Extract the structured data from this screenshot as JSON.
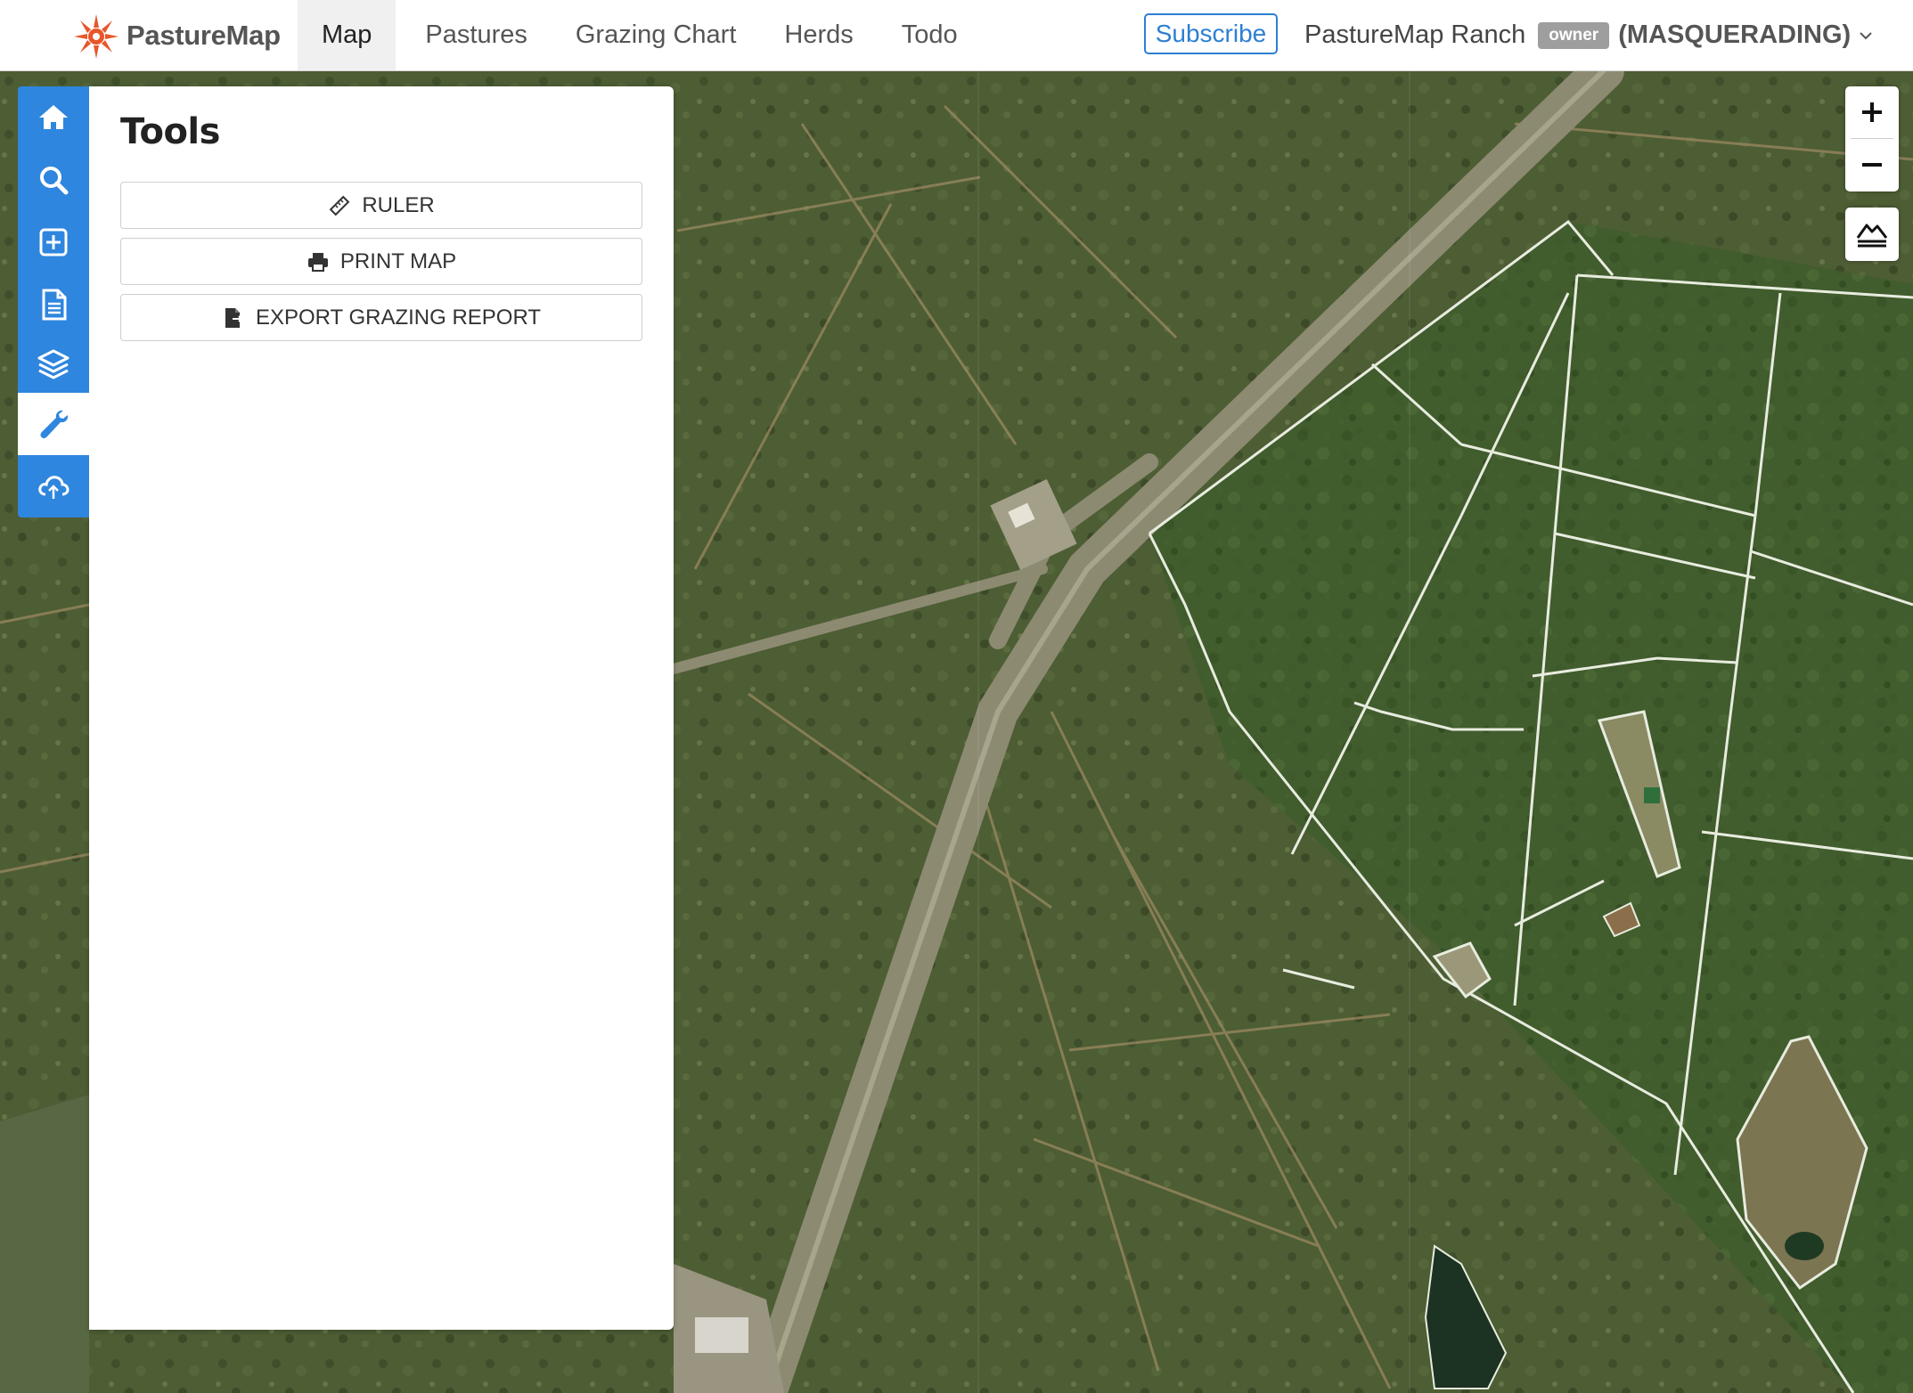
{
  "app": {
    "brand_name": "PastureMap"
  },
  "nav": {
    "items": [
      {
        "label": "Map",
        "active": true
      },
      {
        "label": "Pastures"
      },
      {
        "label": "Grazing Chart"
      },
      {
        "label": "Herds"
      },
      {
        "label": "Todo"
      }
    ]
  },
  "header": {
    "subscribe_label": "Subscribe",
    "ranch_name": "PastureMap Ranch",
    "role_badge": "owner",
    "mode_label": "(MASQUERADING)"
  },
  "sidebar": {
    "icons": [
      "home-icon",
      "search-icon",
      "add-box-icon",
      "document-icon",
      "layers-icon",
      "wrench-icon",
      "cloud-upload-icon"
    ],
    "active": "wrench-icon"
  },
  "tools": {
    "title": "Tools",
    "buttons": [
      {
        "label": "RULER",
        "icon": "ruler-icon"
      },
      {
        "label": "PRINT MAP",
        "icon": "printer-icon"
      },
      {
        "label": "EXPORT GRAZING REPORT",
        "icon": "export-file-icon"
      }
    ]
  },
  "map_controls": {
    "zoom_in": "+",
    "zoom_out": "−"
  },
  "colors": {
    "accent": "#2e86de",
    "subscribe": "#2d7fd3",
    "brand_sun": "#e8562a"
  }
}
